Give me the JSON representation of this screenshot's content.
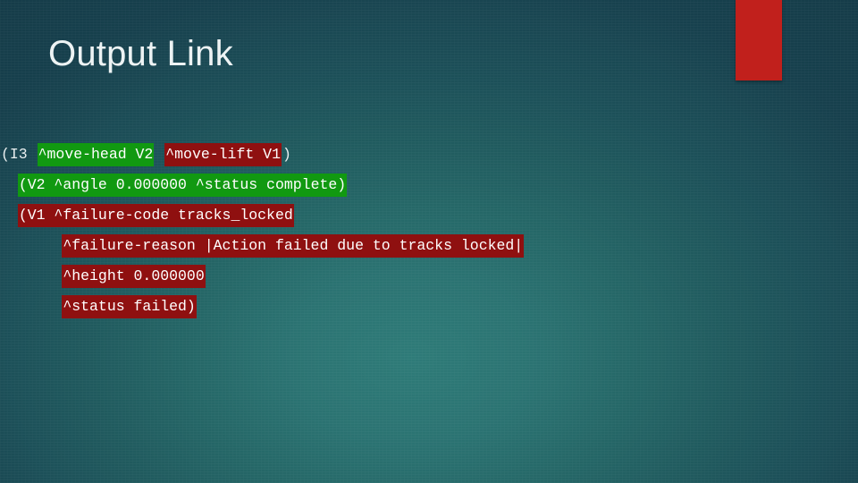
{
  "slide": {
    "title": "Output Link",
    "accent_color": "#c1201c",
    "background_color_dark": "#1b4654",
    "background_color_light": "#2e7b78",
    "highlight_green": "#119911",
    "highlight_red": "#8f1010",
    "text_color": "#ffffff"
  },
  "code": {
    "lines": [
      {
        "indent": "",
        "segments": [
          {
            "style": "plain",
            "text": "(I3 "
          },
          {
            "style": "green",
            "text": "^move-head V2"
          },
          {
            "style": "plain",
            "text": " "
          },
          {
            "style": "red",
            "text": "^move-lift V1"
          },
          {
            "style": "plain",
            "text": ")"
          }
        ]
      },
      {
        "indent": "  ",
        "segments": [
          {
            "style": "green",
            "text": "(V2 ^angle 0.000000 ^status complete)"
          }
        ]
      },
      {
        "indent": "  ",
        "segments": [
          {
            "style": "red",
            "text": "(V1 ^failure-code tracks_locked"
          }
        ]
      },
      {
        "indent": "       ",
        "segments": [
          {
            "style": "red",
            "text": "^failure-reason |Action failed due to tracks locked|"
          }
        ]
      },
      {
        "indent": "       ",
        "segments": [
          {
            "style": "red",
            "text": "^height 0.000000"
          }
        ]
      },
      {
        "indent": "       ",
        "segments": [
          {
            "style": "red",
            "text": "^status failed)"
          }
        ]
      }
    ]
  }
}
